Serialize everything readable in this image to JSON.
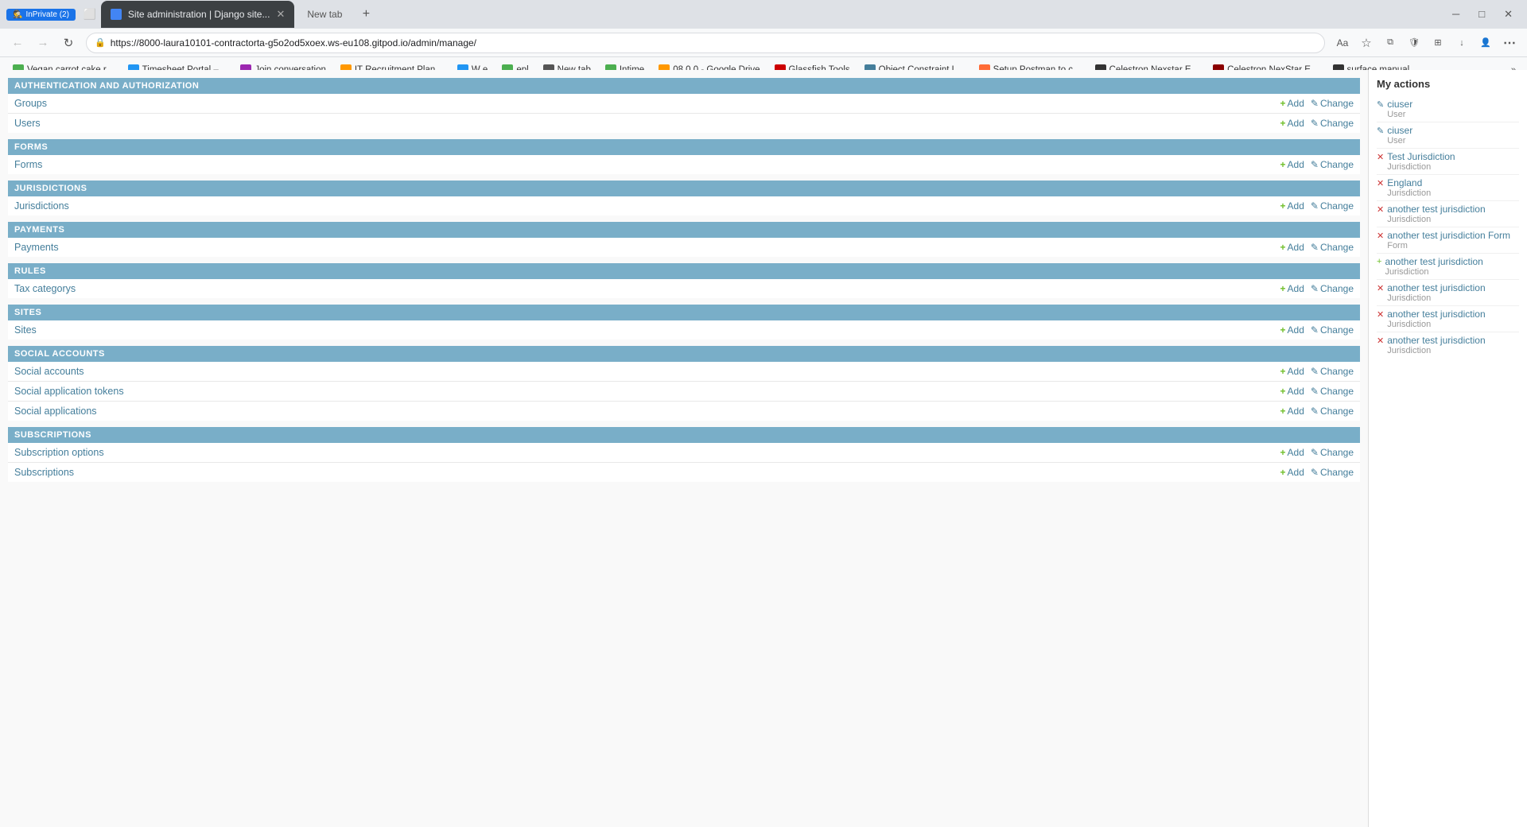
{
  "browser": {
    "active_tab_title": "Site administration | Django site...",
    "new_tab_label": "New tab",
    "add_tab_label": "+",
    "address": "https://8000-laura10101-contractorta-g5o2od5xoex.ws-eu108.gitpod.io/admin/manage/",
    "window_controls": [
      "minimize",
      "maximize",
      "close"
    ]
  },
  "bookmarks": [
    {
      "id": "vegan",
      "label": "Vegan carrot cake r...",
      "color": "#4caf50"
    },
    {
      "id": "timesheet",
      "label": "Timesheet Portal –...",
      "color": "#2196f3"
    },
    {
      "id": "join",
      "label": "Join conversation",
      "color": "#9c27b0"
    },
    {
      "id": "it-recruit",
      "label": "IT Recruitment Plan...",
      "color": "#ff9800"
    },
    {
      "id": "w-e",
      "label": "W  e",
      "color": "#2196f3"
    },
    {
      "id": "epl",
      "label": "epl",
      "color": "#4caf50"
    },
    {
      "id": "new-tab",
      "label": "New tab",
      "color": "#555"
    },
    {
      "id": "intime",
      "label": "Intime",
      "color": "#4caf50"
    },
    {
      "id": "google-drive",
      "label": "08.0.0 - Google Drive",
      "color": "#ff9800"
    },
    {
      "id": "glassfish",
      "label": "Glassfish Tools",
      "color": "#cc0000"
    },
    {
      "id": "object-constraint",
      "label": "Object Constraint L...",
      "color": "#447e9b"
    },
    {
      "id": "postman",
      "label": "Setup Postman to c...",
      "color": "#ff6c37"
    },
    {
      "id": "celestron1",
      "label": "Celestron Nexstar E...",
      "color": "#333"
    },
    {
      "id": "celestron2",
      "label": "Celestron NexStar E...",
      "color": "#8b0000"
    },
    {
      "id": "surface",
      "label": "surface manual",
      "color": "#333"
    }
  ],
  "admin": {
    "sections": [
      {
        "id": "auth",
        "header": "AUTHENTICATION AND AUTHORIZATION",
        "rows": [
          {
            "label": "Groups",
            "add": true,
            "change": true
          },
          {
            "label": "Users",
            "add": true,
            "change": true
          }
        ]
      },
      {
        "id": "forms",
        "header": "FORMS",
        "rows": [
          {
            "label": "Forms",
            "add": true,
            "change": true
          }
        ]
      },
      {
        "id": "jurisdictions",
        "header": "JURISDICTIONS",
        "rows": [
          {
            "label": "Jurisdictions",
            "add": true,
            "change": true
          }
        ]
      },
      {
        "id": "payments",
        "header": "PAYMENTS",
        "rows": [
          {
            "label": "Payments",
            "add": true,
            "change": true
          }
        ]
      },
      {
        "id": "rules",
        "header": "RULES",
        "rows": [
          {
            "label": "Tax categorys",
            "add": true,
            "change": true
          }
        ]
      },
      {
        "id": "sites",
        "header": "SITES",
        "rows": [
          {
            "label": "Sites",
            "add": true,
            "change": true
          }
        ]
      },
      {
        "id": "social-accounts",
        "header": "SOCIAL ACCOUNTS",
        "rows": [
          {
            "label": "Social accounts",
            "add": true,
            "change": true
          },
          {
            "label": "Social application tokens",
            "add": true,
            "change": true
          },
          {
            "label": "Social applications",
            "add": true,
            "change": true
          }
        ]
      },
      {
        "id": "subscriptions",
        "header": "SUBSCRIPTIONS",
        "rows": [
          {
            "label": "Subscription options",
            "add": true,
            "change": true
          },
          {
            "label": "Subscriptions",
            "add": true,
            "change": true
          }
        ]
      }
    ],
    "add_label": "+ Add",
    "change_label": "✎ Change"
  },
  "my_actions": {
    "title": "My actions",
    "items": [
      {
        "icon": "edit",
        "name": "ciuser",
        "type": "User"
      },
      {
        "icon": "edit",
        "name": "ciuser",
        "type": "User"
      },
      {
        "icon": "delete",
        "name": "Test Jurisdiction",
        "type": "Jurisdiction"
      },
      {
        "icon": "delete",
        "name": "England",
        "type": "Jurisdiction"
      },
      {
        "icon": "delete",
        "name": "another test jurisdiction",
        "type": "Jurisdiction"
      },
      {
        "icon": "delete",
        "name": "another test jurisdiction Form",
        "type": "Form"
      },
      {
        "icon": "add",
        "name": "another test jurisdiction",
        "type": "Jurisdiction"
      },
      {
        "icon": "delete",
        "name": "another test jurisdiction",
        "type": "Jurisdiction"
      },
      {
        "icon": "delete",
        "name": "another test jurisdiction",
        "type": "Jurisdiction"
      },
      {
        "icon": "delete",
        "name": "another test jurisdiction",
        "type": "Jurisdiction"
      }
    ]
  }
}
